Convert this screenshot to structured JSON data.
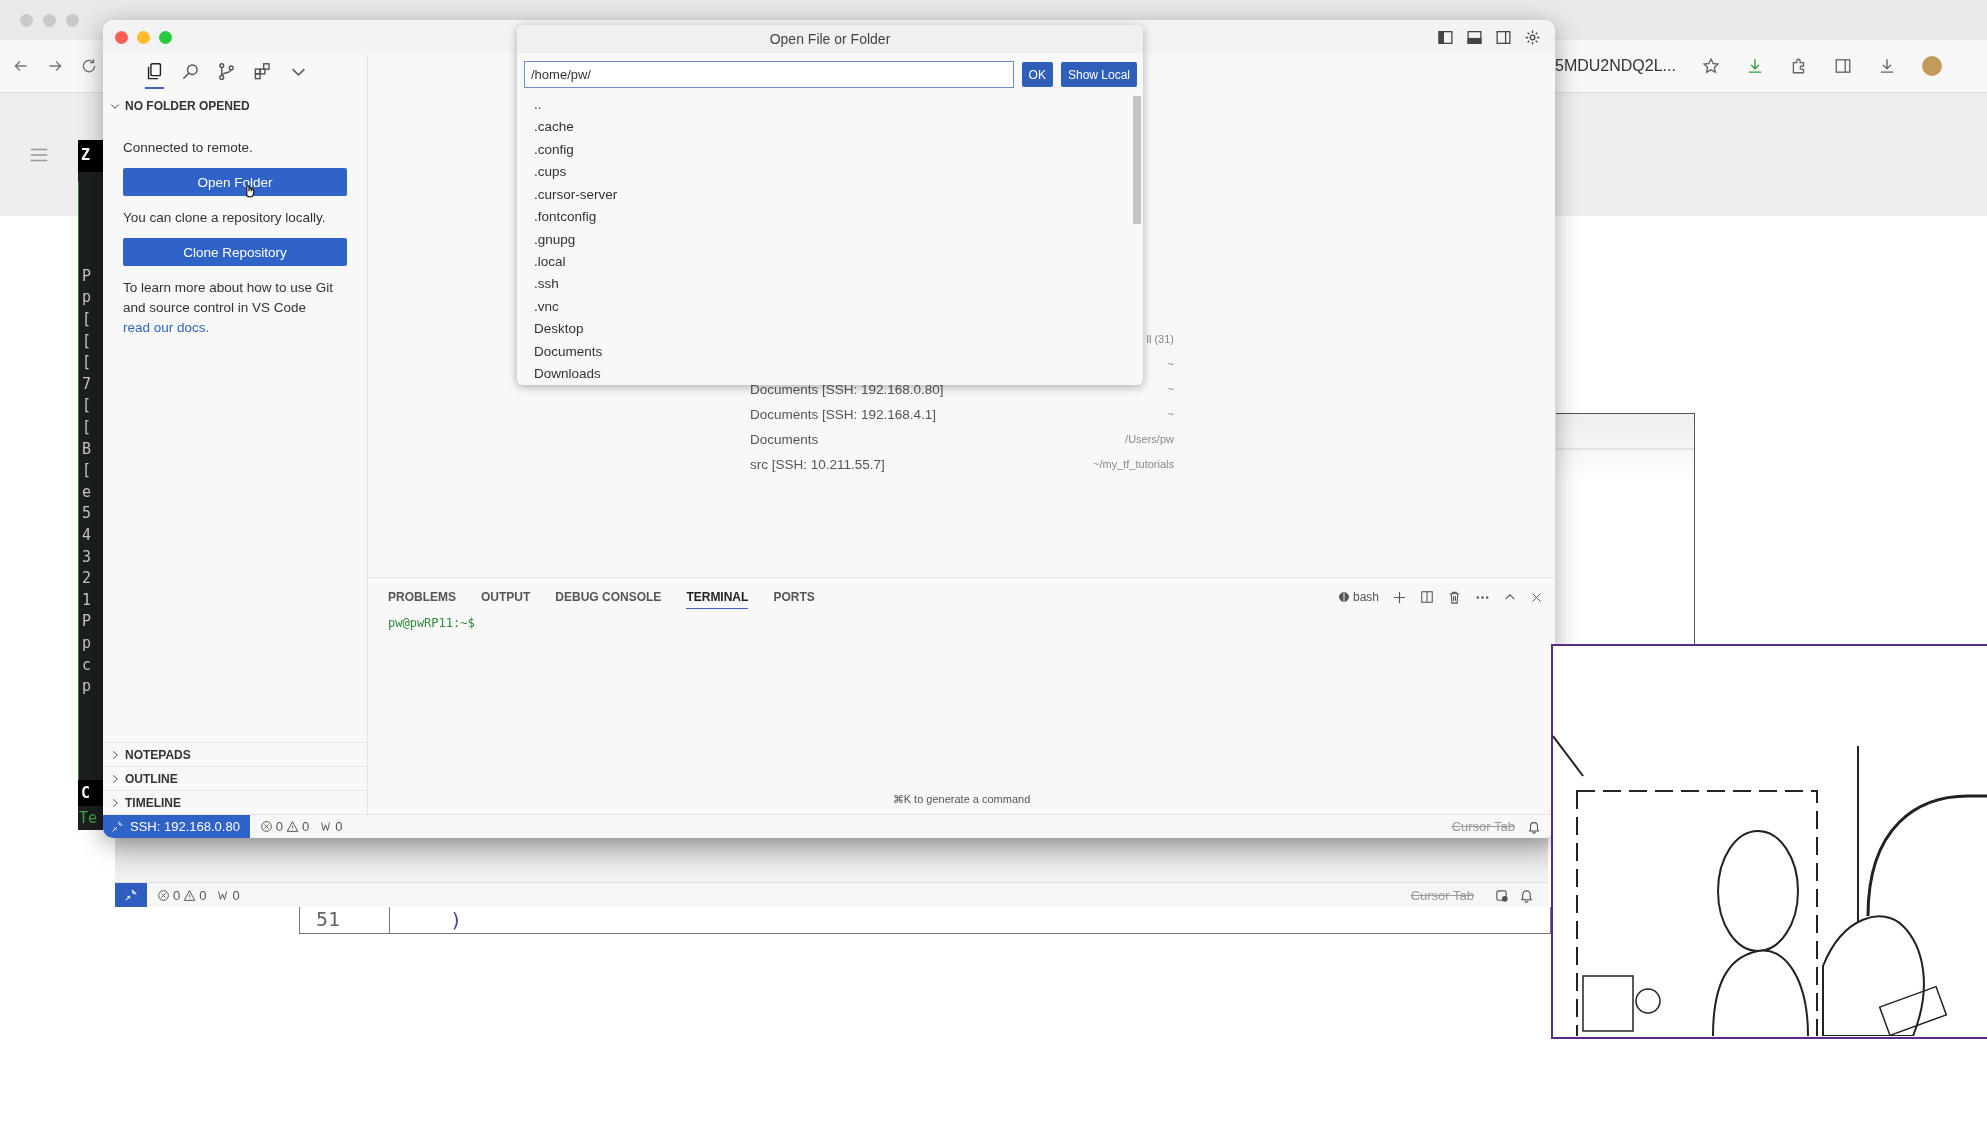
{
  "browser": {
    "address_fragment": "5MDU2NDQ2L..."
  },
  "terminal_strip": {
    "title": "Z",
    "lines": [
      "P",
      "p",
      "[",
      "[",
      "[",
      "7",
      "[",
      "[",
      "B",
      "[",
      "e",
      "5",
      "4",
      "3",
      "2",
      "1",
      "P",
      "p",
      "c",
      "p"
    ],
    "footer": "C",
    "tab": "Te"
  },
  "vscode": {
    "activity": [
      {
        "kind": "explorer",
        "selected": true
      },
      {
        "kind": "search",
        "selected": false
      },
      {
        "kind": "source-control",
        "selected": false
      },
      {
        "kind": "extensions",
        "selected": false
      },
      {
        "kind": "more",
        "selected": false
      }
    ],
    "sidebar": {
      "section_title": "NO FOLDER OPENED",
      "expanded": true,
      "connected_text": "Connected to remote.",
      "open_button": "Open Folder",
      "clone_text": "You can clone a repository locally.",
      "clone_button": "Clone Repository",
      "learn_text": "To learn more about how to use Git and source control in VS Code",
      "learn_link": "read our docs.",
      "sections": [
        {
          "title": "NOTEPADS",
          "expanded": false
        },
        {
          "title": "OUTLINE",
          "expanded": false
        },
        {
          "title": "TIMELINE",
          "expanded": false
        }
      ]
    },
    "recent": [
      {
        "path": "ll (31)"
      },
      {
        "path": "~"
      },
      {
        "name": "Documents [SSH: 192.168.0.80]",
        "path": "~"
      },
      {
        "name": "Documents [SSH: 192.168.4.1]",
        "path": "~"
      },
      {
        "name": "Documents",
        "path": "/Users/pw"
      },
      {
        "name": "src [SSH: 10.211.55.7]",
        "path": "~/my_tf_tutorials"
      }
    ],
    "panel": {
      "tabs": [
        {
          "label": "PROBLEMS",
          "selected": false
        },
        {
          "label": "OUTPUT",
          "selected": false
        },
        {
          "label": "DEBUG CONSOLE",
          "selected": false
        },
        {
          "label": "TERMINAL",
          "selected": true
        },
        {
          "label": "PORTS",
          "selected": false
        }
      ],
      "shell": "bash",
      "prompt": "pw@pwRP11:~$",
      "hint": "⌘K to generate a command"
    },
    "status_bar": {
      "remote": "SSH: 192.168.0.80",
      "errors": "0",
      "warnings": "0",
      "ports": "0",
      "cursor_tab": "Cursor Tab"
    }
  },
  "dialog": {
    "title": "Open File or Folder",
    "path_value": "/home/pw/",
    "buttons": [
      "OK",
      "Show Local"
    ],
    "items": [
      "..",
      ".cache",
      ".config",
      ".cups",
      ".cursor-server",
      ".fontconfig",
      ".gnupg",
      ".local",
      ".ssh",
      ".vnc",
      "Desktop",
      "Documents",
      "Downloads"
    ]
  },
  "background_window": {
    "status_bar": {
      "errors": "0",
      "warnings": "0",
      "ports": "0",
      "cursor_tab": "Cursor Tab"
    },
    "line_number": "51",
    "code": ")"
  }
}
